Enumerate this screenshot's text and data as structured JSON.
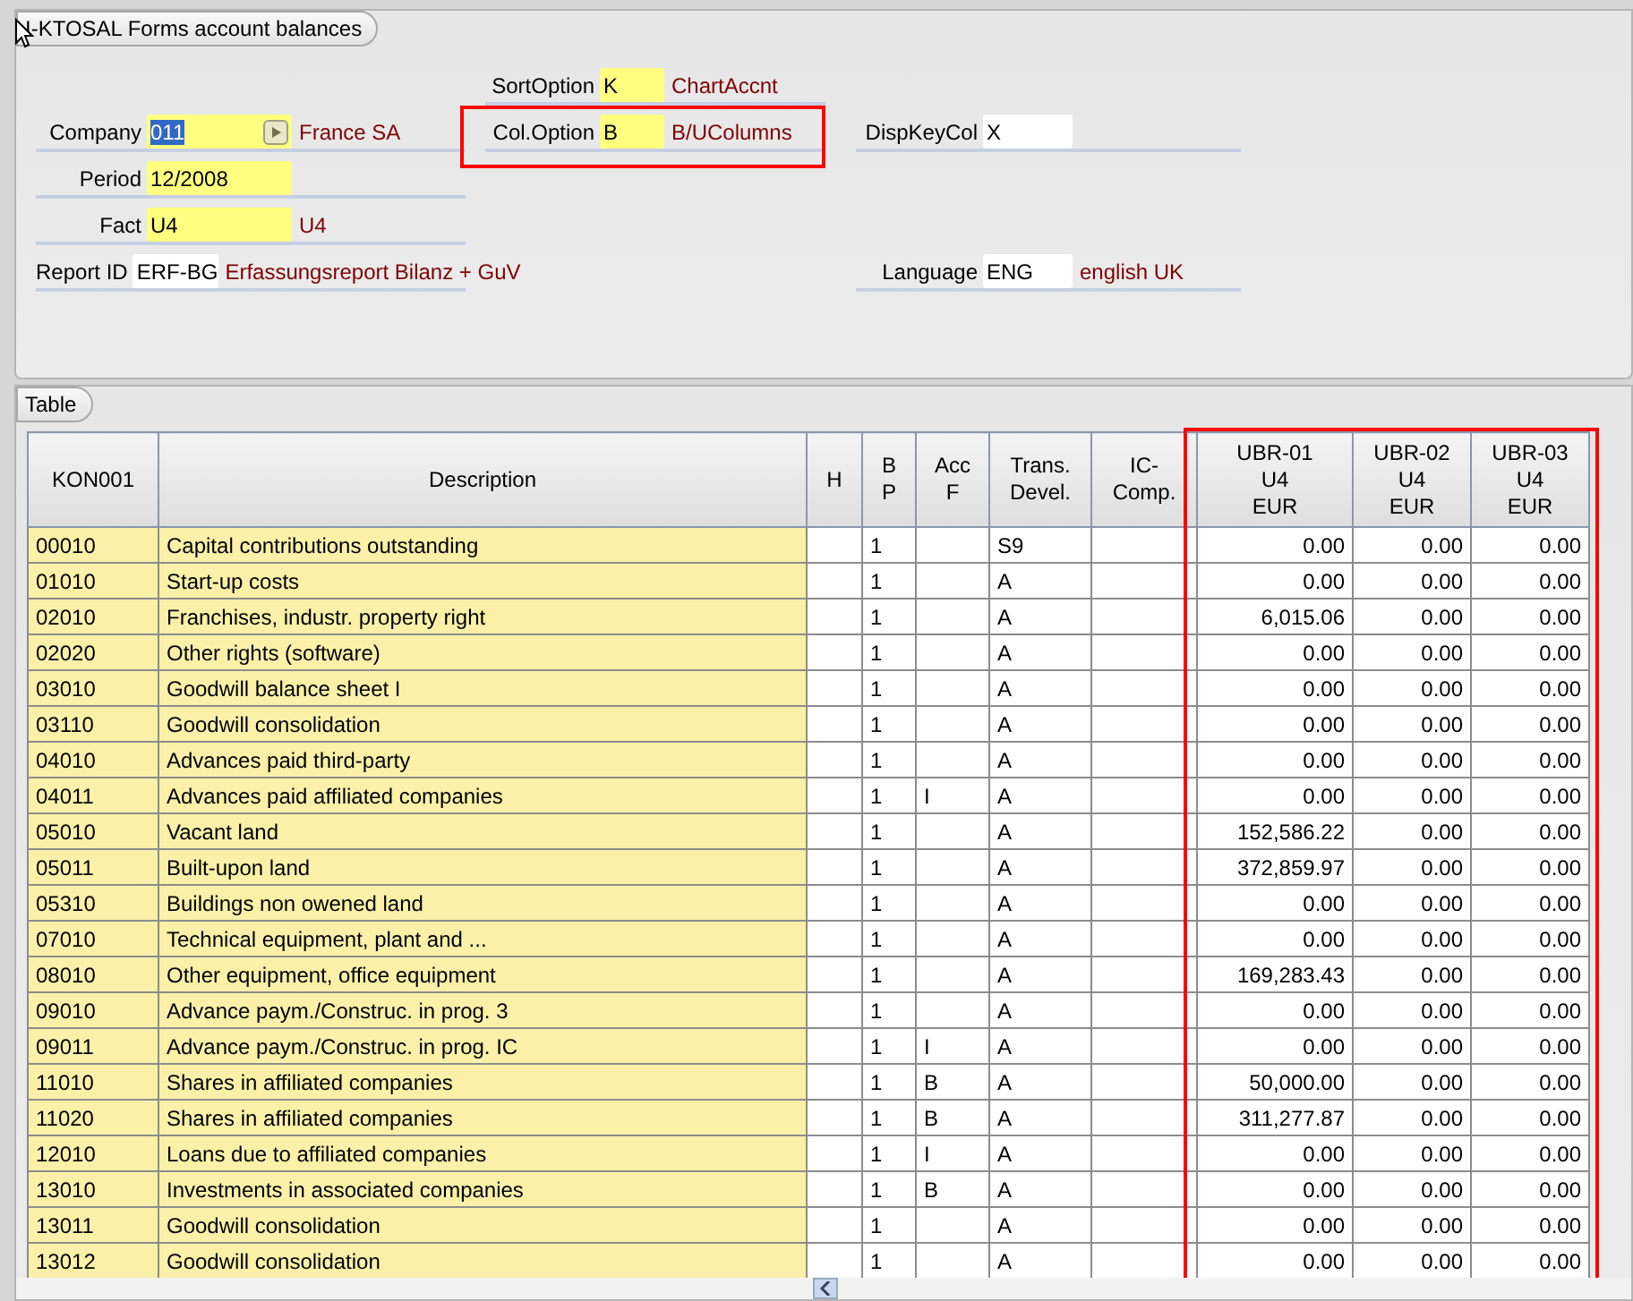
{
  "form": {
    "tab": "I-KTOSAL Forms account balances",
    "rows": [
      {
        "middle": {
          "label": "SortOption",
          "value": "K",
          "description": "ChartAccnt",
          "required": true
        }
      },
      {
        "left": {
          "label": "Company",
          "value": "011",
          "description": "France SA",
          "required": true,
          "lookup": true,
          "value_selected": true
        },
        "middle": {
          "label": "Col.Option",
          "value": "B",
          "description": "B/UColumns",
          "required": true,
          "highlighted": true
        },
        "right": {
          "label": "DispKeyCol",
          "value": "X",
          "required": false
        }
      },
      {
        "left": {
          "label": "Period",
          "value": "12/2008",
          "required": true
        }
      },
      {
        "left": {
          "label": "Fact",
          "value": "U4",
          "description": "U4",
          "required": true
        }
      },
      {
        "left": {
          "label": "Report ID",
          "value": "ERF-BG",
          "description": "Erfassungsreport Bilanz + GuV",
          "required": false
        },
        "right": {
          "label": "Language",
          "value": "ENG",
          "description": "english UK",
          "required": false
        }
      }
    ]
  },
  "table": {
    "tab": "Table",
    "amount_columns_highlighted": true,
    "columns": [
      "KON001",
      "Description",
      "H",
      "B\nP",
      "Acc\nF",
      "Trans.\nDevel.",
      "IC-\nComp.",
      "UBR-01\nU4\nEUR",
      "UBR-02\nU4\nEUR",
      "UBR-03\nU4\nEUR"
    ],
    "rows": [
      [
        "00010",
        "Capital contributions outstanding",
        "",
        "1",
        "",
        "S9",
        "",
        "0.00",
        "0.00",
        "0.00"
      ],
      [
        "01010",
        "Start-up costs",
        "",
        "1",
        "",
        "A",
        "",
        "0.00",
        "0.00",
        "0.00"
      ],
      [
        "02010",
        "Franchises, industr. property right",
        "",
        "1",
        "",
        "A",
        "",
        "6,015.06",
        "0.00",
        "0.00"
      ],
      [
        "02020",
        "Other rights (software)",
        "",
        "1",
        "",
        "A",
        "",
        "0.00",
        "0.00",
        "0.00"
      ],
      [
        "03010",
        "Goodwill balance sheet I",
        "",
        "1",
        "",
        "A",
        "",
        "0.00",
        "0.00",
        "0.00"
      ],
      [
        "03110",
        "Goodwill consolidation",
        "",
        "1",
        "",
        "A",
        "",
        "0.00",
        "0.00",
        "0.00"
      ],
      [
        "04010",
        "Advances paid third-party",
        "",
        "1",
        "",
        "A",
        "",
        "0.00",
        "0.00",
        "0.00"
      ],
      [
        "04011",
        "Advances paid affiliated companies",
        "",
        "1",
        "I",
        "A",
        "",
        "0.00",
        "0.00",
        "0.00"
      ],
      [
        "05010",
        "Vacant land",
        "",
        "1",
        "",
        "A",
        "",
        "152,586.22",
        "0.00",
        "0.00"
      ],
      [
        "05011",
        "Built-upon land",
        "",
        "1",
        "",
        "A",
        "",
        "372,859.97",
        "0.00",
        "0.00"
      ],
      [
        "05310",
        "Buildings non owened land",
        "",
        "1",
        "",
        "A",
        "",
        "0.00",
        "0.00",
        "0.00"
      ],
      [
        "07010",
        "Technical equipment, plant and ...",
        "",
        "1",
        "",
        "A",
        "",
        "0.00",
        "0.00",
        "0.00"
      ],
      [
        "08010",
        "Other equipment, office equipment",
        "",
        "1",
        "",
        "A",
        "",
        "169,283.43",
        "0.00",
        "0.00"
      ],
      [
        "09010",
        "Advance paym./Construc. in prog. 3",
        "",
        "1",
        "",
        "A",
        "",
        "0.00",
        "0.00",
        "0.00"
      ],
      [
        "09011",
        "Advance paym./Construc. in prog. IC",
        "",
        "1",
        "I",
        "A",
        "",
        "0.00",
        "0.00",
        "0.00"
      ],
      [
        "11010",
        "Shares in affiliated companies",
        "",
        "1",
        "B",
        "A",
        "",
        "50,000.00",
        "0.00",
        "0.00"
      ],
      [
        "11020",
        "Shares in affiliated companies",
        "",
        "1",
        "B",
        "A",
        "",
        "311,277.87",
        "0.00",
        "0.00"
      ],
      [
        "12010",
        "Loans due to affiliated companies",
        "",
        "1",
        "I",
        "A",
        "",
        "0.00",
        "0.00",
        "0.00"
      ],
      [
        "13010",
        "Investments in associated companies",
        "",
        "1",
        "B",
        "A",
        "",
        "0.00",
        "0.00",
        "0.00"
      ],
      [
        "13011",
        "Goodwill consolidation",
        "",
        "1",
        "",
        "A",
        "",
        "0.00",
        "0.00",
        "0.00"
      ],
      [
        "13012",
        "Goodwill consolidation",
        "",
        "1",
        "",
        "A",
        "",
        "0.00",
        "0.00",
        "0.00"
      ]
    ]
  }
}
